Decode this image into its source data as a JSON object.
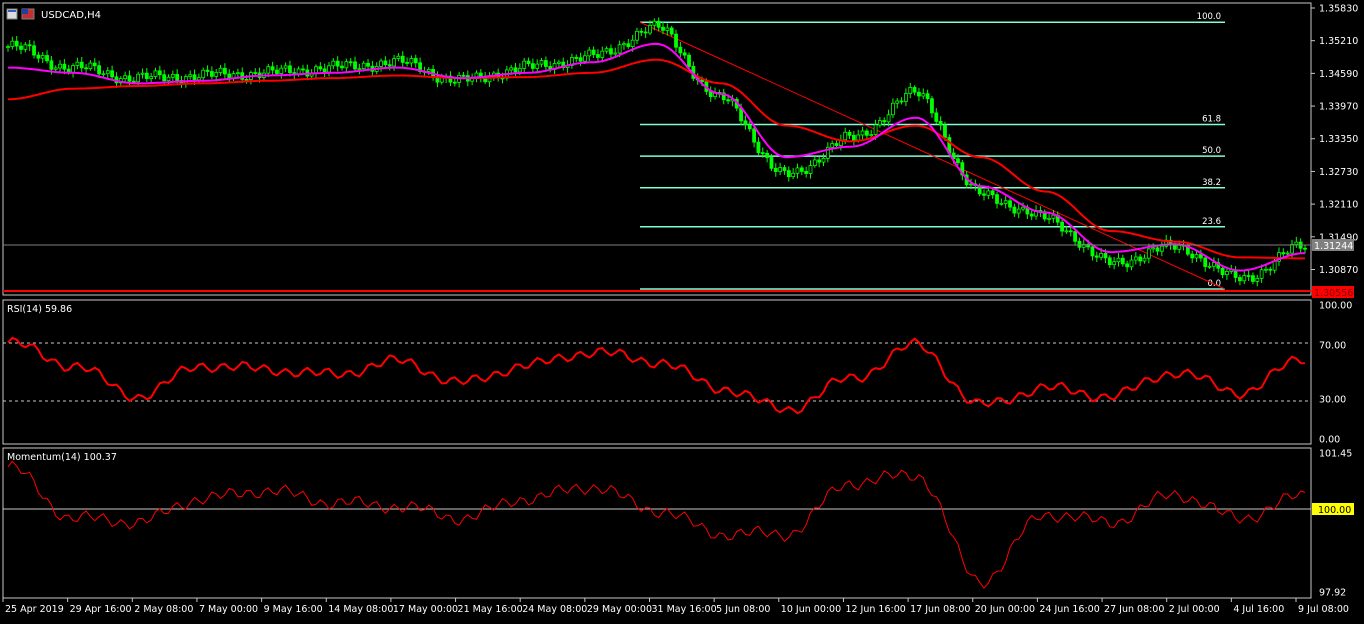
{
  "window": {
    "symbol_title": "USDCAD,H4"
  },
  "colors": {
    "background": "#000000",
    "frame": "#c8c8c8",
    "bull_candle": "#00ff00",
    "ma_fast": "#ff00ff",
    "ma_slow": "#ff0000",
    "fib": "#7fffd4",
    "trendline": "#ff0000",
    "current_price_line": "#808080",
    "current_price_box": "#808080",
    "low_price_box": "#ff0000",
    "indicator_line": "#ff0000",
    "momentum_level_box": "#ffff00"
  },
  "price_panel": {
    "current_price": "1.31244",
    "low_price_label": "1.30556",
    "axis_ticks": [
      "1.35830",
      "1.35210",
      "1.34590",
      "1.33970",
      "1.33350",
      "1.32730",
      "1.32110",
      "1.31490",
      "1.30870"
    ],
    "fib_levels": [
      {
        "label": "100.0",
        "price": 1.3556
      },
      {
        "label": "61.8",
        "price": 1.3362
      },
      {
        "label": "50.0",
        "price": 1.3302
      },
      {
        "label": "38.2",
        "price": 1.3242
      },
      {
        "label": "23.6",
        "price": 1.3168
      },
      {
        "label": "0.0",
        "price": 1.305
      }
    ]
  },
  "rsi_panel": {
    "label": "RSI(14) 59.86",
    "axis_ticks": [
      "100.00",
      "70.00",
      "30.00",
      "0.00"
    ],
    "levels": [
      70,
      30
    ]
  },
  "momentum_panel": {
    "label": "Momentum(14) 100.37",
    "axis_ticks": [
      "101.45",
      "97.92"
    ],
    "level_label": "100.00"
  },
  "time_axis": {
    "labels": [
      "25 Apr 2019",
      "29 Apr 16:00",
      "2 May 08:00",
      "7 May 00:00",
      "9 May 16:00",
      "14 May 08:00",
      "17 May 00:00",
      "21 May 16:00",
      "24 May 08:00",
      "29 May 00:00",
      "31 May 16:00",
      "5 Jun 08:00",
      "10 Jun 00:00",
      "12 Jun 16:00",
      "17 Jun 08:00",
      "20 Jun 00:00",
      "24 Jun 16:00",
      "27 Jun 08:00",
      "2 Jul 00:00",
      "4 Jul 16:00",
      "9 Jul 08:00"
    ]
  },
  "chart_data": [
    {
      "type": "line",
      "title": "USDCAD,H4",
      "xlabel": "",
      "ylabel": "",
      "ylim": [
        1.305,
        1.3583
      ],
      "x": [
        "25 Apr 2019",
        "29 Apr 16:00",
        "2 May 08:00",
        "7 May 00:00",
        "9 May 16:00",
        "14 May 08:00",
        "17 May 00:00",
        "21 May 16:00",
        "24 May 08:00",
        "29 May 00:00",
        "31 May 16:00",
        "5 Jun 08:00",
        "10 Jun 00:00",
        "12 Jun 16:00",
        "17 Jun 08:00",
        "20 Jun 00:00",
        "24 Jun 16:00",
        "27 Jun 08:00",
        "2 Jul 00:00",
        "4 Jul 16:00",
        "9 Jul 08:00"
      ],
      "series": [
        {
          "values": [
            1.351,
            1.347,
            1.345,
            1.3455,
            1.346,
            1.347,
            1.348,
            1.3445,
            1.347,
            1.349,
            1.3545,
            1.341,
            1.3265,
            1.3335,
            1.342,
            1.323,
            1.3185,
            1.31,
            1.313,
            1.307,
            1.313
          ]
        },
        {
          "values": [
            1.347,
            1.346,
            1.344,
            1.3445,
            1.3455,
            1.346,
            1.347,
            1.345,
            1.346,
            1.348,
            1.3515,
            1.342,
            1.33,
            1.332,
            1.3375,
            1.3245,
            1.3195,
            1.312,
            1.3135,
            1.3085,
            1.3118
          ]
        },
        {
          "values": [
            1.341,
            1.343,
            1.3435,
            1.344,
            1.3445,
            1.345,
            1.3455,
            1.345,
            1.3452,
            1.346,
            1.3485,
            1.344,
            1.336,
            1.333,
            1.336,
            1.33,
            1.3235,
            1.316,
            1.314,
            1.311,
            1.3108
          ]
        }
      ]
    },
    {
      "type": "line",
      "title": "RSI(14) 59.86",
      "ylim": [
        0,
        100
      ],
      "x": [
        "25 Apr 2019",
        "29 Apr 16:00",
        "2 May 08:00",
        "7 May 00:00",
        "9 May 16:00",
        "14 May 08:00",
        "17 May 00:00",
        "21 May 16:00",
        "24 May 08:00",
        "29 May 00:00",
        "31 May 16:00",
        "5 Jun 08:00",
        "10 Jun 00:00",
        "12 Jun 16:00",
        "17 Jun 08:00",
        "20 Jun 00:00",
        "24 Jun 16:00",
        "27 Jun 08:00",
        "2 Jul 00:00",
        "4 Jul 16:00",
        "9 Jul 08:00"
      ],
      "series": [
        {
          "values": [
            72,
            55,
            32,
            55,
            52,
            48,
            58,
            42,
            55,
            65,
            58,
            38,
            22,
            45,
            70,
            25,
            38,
            32,
            50,
            35,
            60
          ]
        }
      ]
    },
    {
      "type": "line",
      "title": "Momentum(14) 100.37",
      "ylim": [
        97.92,
        101.45
      ],
      "x": [
        "25 Apr 2019",
        "29 Apr 16:00",
        "2 May 08:00",
        "7 May 00:00",
        "9 May 16:00",
        "14 May 08:00",
        "17 May 00:00",
        "21 May 16:00",
        "24 May 08:00",
        "29 May 00:00",
        "31 May 16:00",
        "5 Jun 08:00",
        "10 Jun 00:00",
        "12 Jun 16:00",
        "17 Jun 08:00",
        "20 Jun 00:00",
        "24 Jun 16:00",
        "27 Jun 08:00",
        "2 Jul 00:00",
        "4 Jul 16:00",
        "9 Jul 08:00"
      ],
      "series": [
        {
          "values": [
            101.1,
            99.8,
            99.7,
            100.3,
            100.5,
            100.2,
            100.1,
            99.8,
            100.3,
            100.6,
            100.0,
            99.4,
            99.4,
            100.7,
            100.9,
            98.2,
            99.9,
            99.7,
            100.4,
            99.8,
            100.37
          ]
        }
      ]
    }
  ]
}
